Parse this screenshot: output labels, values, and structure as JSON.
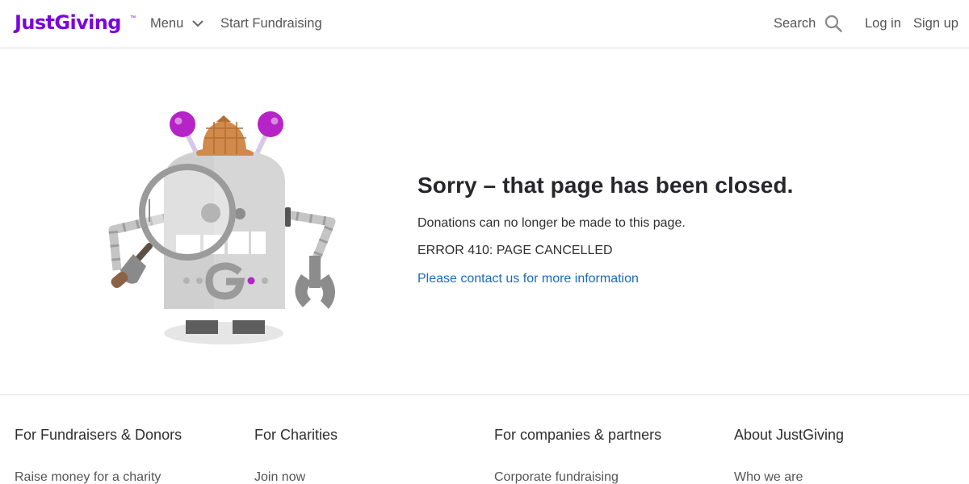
{
  "header": {
    "logo_text": "JustGiving",
    "logo_tm": "™",
    "menu_label": "Menu",
    "start_fundraising_label": "Start Fundraising",
    "search_label": "Search",
    "login_label": "Log in",
    "signup_label": "Sign up"
  },
  "main": {
    "title": "Sorry – that page has been closed.",
    "description": "Donations can no longer be made to this page.",
    "error_code": "ERROR 410: PAGE CANCELLED",
    "contact_link": "Please contact us for more information"
  },
  "footer": {
    "columns": [
      {
        "heading": "For Fundraisers & Donors",
        "first_link": "Raise money for a charity"
      },
      {
        "heading": "For Charities",
        "first_link": "Join now"
      },
      {
        "heading": "For companies & partners",
        "first_link": "Corporate fundraising"
      },
      {
        "heading": "About JustGiving",
        "first_link": "Who we are"
      }
    ]
  },
  "colors": {
    "brand": "#7a04dd",
    "link": "#1a6bb8",
    "robot_body": "#d6d6d6",
    "robot_accent": "#b623c6",
    "hat": "#d18a4b"
  },
  "icons": [
    "chevron-down-icon",
    "search-icon",
    "detective-robot-illustration"
  ]
}
